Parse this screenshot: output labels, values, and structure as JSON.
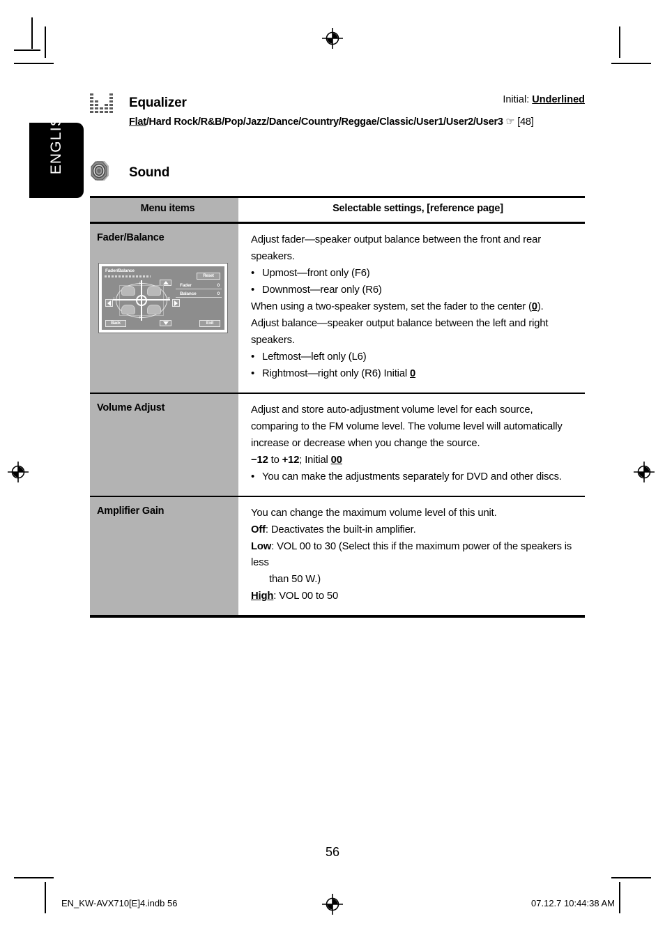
{
  "side_tab": {
    "label": "ENGLISH"
  },
  "initial_note": {
    "prefix": "Initial: ",
    "value": "Underlined"
  },
  "equalizer_section": {
    "icon": "equalizer-icon",
    "title": "Equalizer",
    "options": "Flat/Hard Rock/R&B/Pop/Jazz/Dance/Country/Reggae/Classic/User1/User2/User3",
    "underlined_option": "Flat",
    "rest_options": "/Hard Rock/R&B/Pop/Jazz/Dance/Country/Reggae/Classic/User1/User2/User3",
    "hand_icon": "☞",
    "reference_page": "[48]"
  },
  "sound_section": {
    "icon": "speaker-icon",
    "title": "Sound"
  },
  "table": {
    "headers": [
      "Menu items",
      "Selectable settings, [reference page]"
    ],
    "rows": [
      {
        "menu_item": "Fader/Balance",
        "has_image": true,
        "lines": [
          {
            "type": "p",
            "text": "Adjust fader—speaker output balance between the front and rear speakers."
          },
          {
            "type": "bullet",
            "text": "Upmost—front only (F6)"
          },
          {
            "type": "bullet",
            "text": "Downmost—rear only (R6)"
          },
          {
            "type": "p_rich",
            "pre": "When using a two-speaker system, set the fader to the center (",
            "bold_u": "0",
            "post": ")."
          },
          {
            "type": "p",
            "text": "Adjust balance—speaker output balance between the left and right speakers."
          },
          {
            "type": "bullet",
            "text": "Leftmost—left only (L6)"
          },
          {
            "type": "bullet_rich",
            "pre": "Rightmost—right only (R6)  Initial ",
            "bold_u": "0",
            "post": ""
          }
        ]
      },
      {
        "menu_item": "Volume Adjust",
        "has_image": false,
        "lines": [
          {
            "type": "p",
            "text": "Adjust and store auto-adjustment volume level for each source, comparing to the FM volume level. The volume level will automatically increase or decrease when you change the source."
          },
          {
            "type": "range",
            "min": "−12",
            "mid": " to ",
            "max": "+12",
            "tail": "; Initial ",
            "bold_u": "00"
          },
          {
            "type": "bullet",
            "text": "You can make the adjustments separately for DVD and other discs."
          }
        ]
      },
      {
        "menu_item": "Amplifier Gain",
        "has_image": false,
        "lines": [
          {
            "type": "p",
            "text": "You can change the maximum volume level of this unit."
          },
          {
            "type": "p_label",
            "label": "Off",
            "text": ": Deactivates the built-in amplifier."
          },
          {
            "type": "p_label",
            "label": "Low",
            "text": ": VOL 00 to 30 (Select this if the maximum power of the speakers is less"
          },
          {
            "type": "p_indent",
            "text": "than 50 W.)"
          },
          {
            "type": "p_label_u",
            "label": "High",
            "text": ": VOL 00 to 50"
          }
        ]
      }
    ]
  },
  "device_screenshot": {
    "title": "Fader/Balance",
    "reset_button": "Reset",
    "back_button": "Back",
    "exit_button": "Exit",
    "fader_label": "Fader",
    "fader_value": "0",
    "balance_label": "Balance",
    "balance_value": "0",
    "marker_front": "F",
    "marker_rear": "R",
    "marker_left": "L",
    "marker_right": "R"
  },
  "page_number": "56",
  "footer": {
    "left": "EN_KW-AVX710[E]4.indb   56",
    "right": "07.12.7   10:44:38 AM"
  },
  "colors": {
    "table_gray": "#b3b3b3",
    "tab_black": "#000000",
    "device_gray": "#8d8d8d"
  }
}
